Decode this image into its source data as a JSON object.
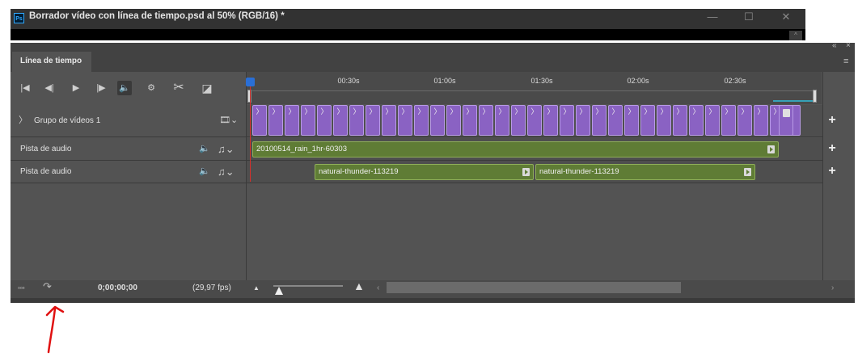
{
  "window": {
    "title": "Borrador vídeo con línea de tiempo.psd al 50% (RGB/16) *",
    "app_icon": "Ps",
    "controls": {
      "minimize": "—",
      "maximize": "☐",
      "close": "✕"
    }
  },
  "panel": {
    "tab_label": "Línea de tiempo",
    "collapse_glyph": "«",
    "close_glyph": "×",
    "menu_glyph": "≡"
  },
  "toolbar": {
    "buttons": [
      {
        "name": "go-to-first-frame",
        "glyph": "|◀"
      },
      {
        "name": "previous-frame",
        "glyph": "◀|"
      },
      {
        "name": "play",
        "glyph": "▶"
      },
      {
        "name": "next-frame",
        "glyph": "|▶"
      },
      {
        "name": "mute-audio",
        "glyph": "🔈"
      },
      {
        "name": "settings",
        "glyph": "⚙"
      },
      {
        "name": "split-at-playhead",
        "glyph": "✂"
      },
      {
        "name": "transition",
        "glyph": "◪"
      }
    ]
  },
  "ruler": {
    "labels": [
      "00:30s",
      "01:00s",
      "01:30s",
      "02:00s",
      "02:30s"
    ]
  },
  "tracks": [
    {
      "label": "Grupo de vídeos 1",
      "type": "video"
    },
    {
      "label": "Pista de audio",
      "type": "audio"
    },
    {
      "label": "Pista de audio",
      "type": "audio"
    }
  ],
  "clips": {
    "audio1": [
      "20100514_rain_1hr-60303"
    ],
    "audio2": [
      "natural-thunder-113219",
      "natural-thunder-113219"
    ],
    "video_clip_glyph": "〉",
    "video_clip_count": 34
  },
  "footer": {
    "timecode": "0;00;00;00",
    "fps": "(29,97 fps)",
    "render_icon": "▫▫▫",
    "share_icon": "↷",
    "zoom_out_glyph": "▲",
    "zoom_in_glyph": "▲",
    "scroll_left": "‹",
    "scroll_right": "›"
  },
  "colors": {
    "video_clip": "#8a62c3",
    "audio_clip": "#5f7c35",
    "playhead": "#2a6fd6",
    "annotation_arrow": "#e01010"
  }
}
